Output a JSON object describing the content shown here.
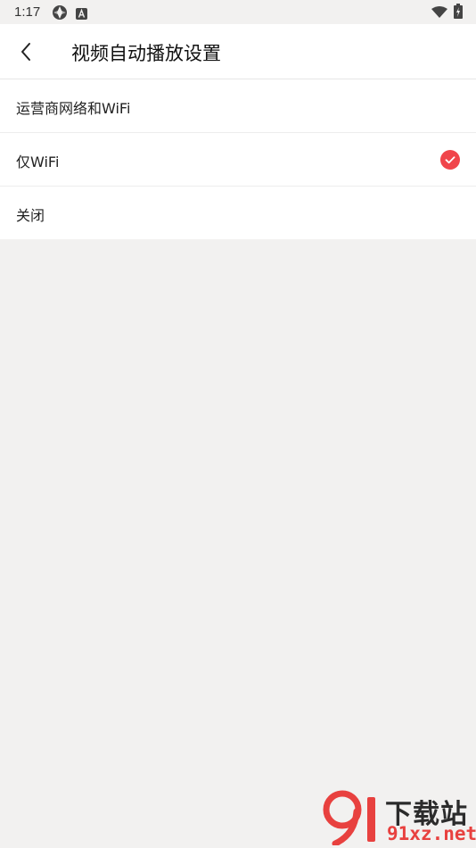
{
  "status_bar": {
    "time": "1:17",
    "icons": [
      "app-notification-icon",
      "a-notification-icon",
      "wifi-icon",
      "battery-charging-icon"
    ]
  },
  "header": {
    "back_icon": "chevron-left-icon",
    "title": "视频自动播放设置"
  },
  "options": [
    {
      "label": "运营商网络和WiFi",
      "selected": false
    },
    {
      "label": "仅WiFi",
      "selected": true
    },
    {
      "label": "关闭",
      "selected": false
    }
  ],
  "colors": {
    "accent": "#f0454b",
    "background": "#f2f1f0",
    "surface": "#ffffff"
  },
  "watermark": {
    "top_text": "下载站",
    "bottom_text": "91xz.net"
  }
}
